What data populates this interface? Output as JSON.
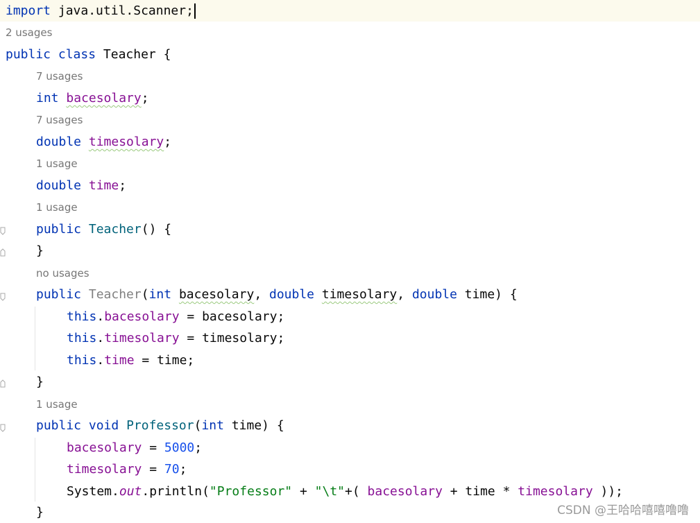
{
  "code": {
    "import": [
      "import",
      " java.util.Scanner;"
    ],
    "class_decl": [
      "public",
      " ",
      "class",
      " Teacher {"
    ],
    "field1": [
      "int",
      " ",
      "bacesolary",
      ";"
    ],
    "field2": [
      "double",
      " ",
      "timesolary",
      ";"
    ],
    "field3": [
      "double",
      " ",
      "time",
      ";"
    ],
    "ctor1": [
      "public",
      " ",
      "Teacher",
      "() {"
    ],
    "close1": "}",
    "ctor2_parts": [
      "public",
      " ",
      "Teacher",
      "(",
      "int",
      " ",
      "bacesolary",
      ", ",
      "double",
      " ",
      "timesolary",
      ", ",
      "double",
      " time) {"
    ],
    "assign1": [
      "this",
      ".",
      "bacesolary",
      " = bacesolary;"
    ],
    "assign2": [
      "this",
      ".",
      "timesolary",
      " = timesolary;"
    ],
    "assign3": [
      "this",
      ".",
      "time",
      " = time;"
    ],
    "close2": "}",
    "method_parts": [
      "public",
      " ",
      "void",
      " ",
      "Professor",
      "(",
      "int",
      " time) {"
    ],
    "stmt1": [
      "bacesolary",
      " = ",
      "5000",
      ";"
    ],
    "stmt2": [
      "timesolary",
      " = ",
      "70",
      ";"
    ],
    "stmt3": [
      "System.",
      "out",
      ".println(",
      "\"Professor\"",
      " + ",
      "\"\\t\"",
      "+( ",
      "bacesolary",
      " + time * ",
      "timesolary",
      " ));"
    ],
    "close3": "}"
  },
  "hints": {
    "h1": "2 usages",
    "h2": "7 usages",
    "h3": "7 usages",
    "h4": "1 usage",
    "h5": "1 usage",
    "h6": "no usages",
    "h7": "1 usage"
  },
  "watermark": "CSDN @王哈哈嘻嘻噜噜"
}
